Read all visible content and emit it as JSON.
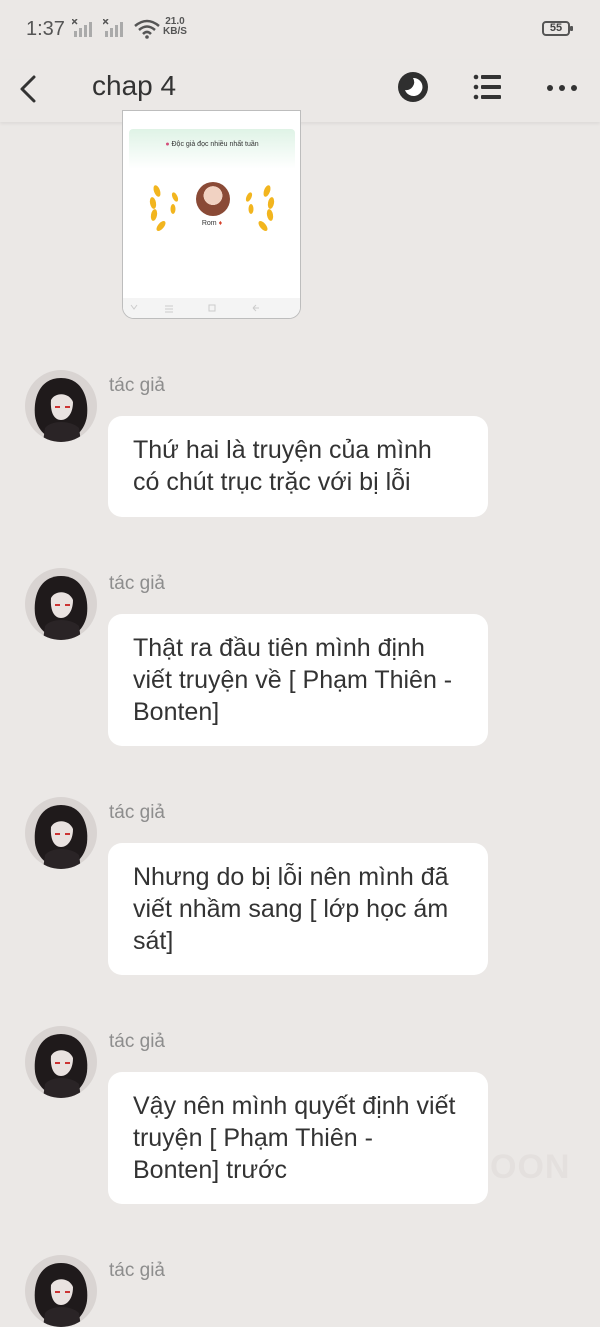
{
  "status_bar": {
    "time": "1:37",
    "net_speed_value": "21.0",
    "net_speed_unit": "KB/S",
    "battery": "55"
  },
  "header": {
    "title": "chap 4",
    "back_icon": "back-arrow-icon",
    "actions": [
      "night-mode-icon",
      "list-icon",
      "more-icon"
    ]
  },
  "embedded_screenshot": {
    "heading": "Độc giả đọc nhiều nhất tuần",
    "name": "Rom"
  },
  "messages": [
    {
      "author": "tác giả",
      "text": "Thứ hai là truyện của mình có chút trục trặc với bị lỗi"
    },
    {
      "author": "tác giả",
      "text": "Thật ra đầu tiên mình định viết truyện về [ Phạm Thiên - Bonten]"
    },
    {
      "author": "tác giả",
      "text": "Nhưng do bị lỗi nên mình đã viết nhầm sang [ lớp học ám sát]"
    },
    {
      "author": "tác giả",
      "text": "Vậy nên mình quyết định viết truyện [ Phạm Thiên - Bonten] trước"
    },
    {
      "author": "tác giả",
      "text": ""
    }
  ],
  "watermark": "OON"
}
